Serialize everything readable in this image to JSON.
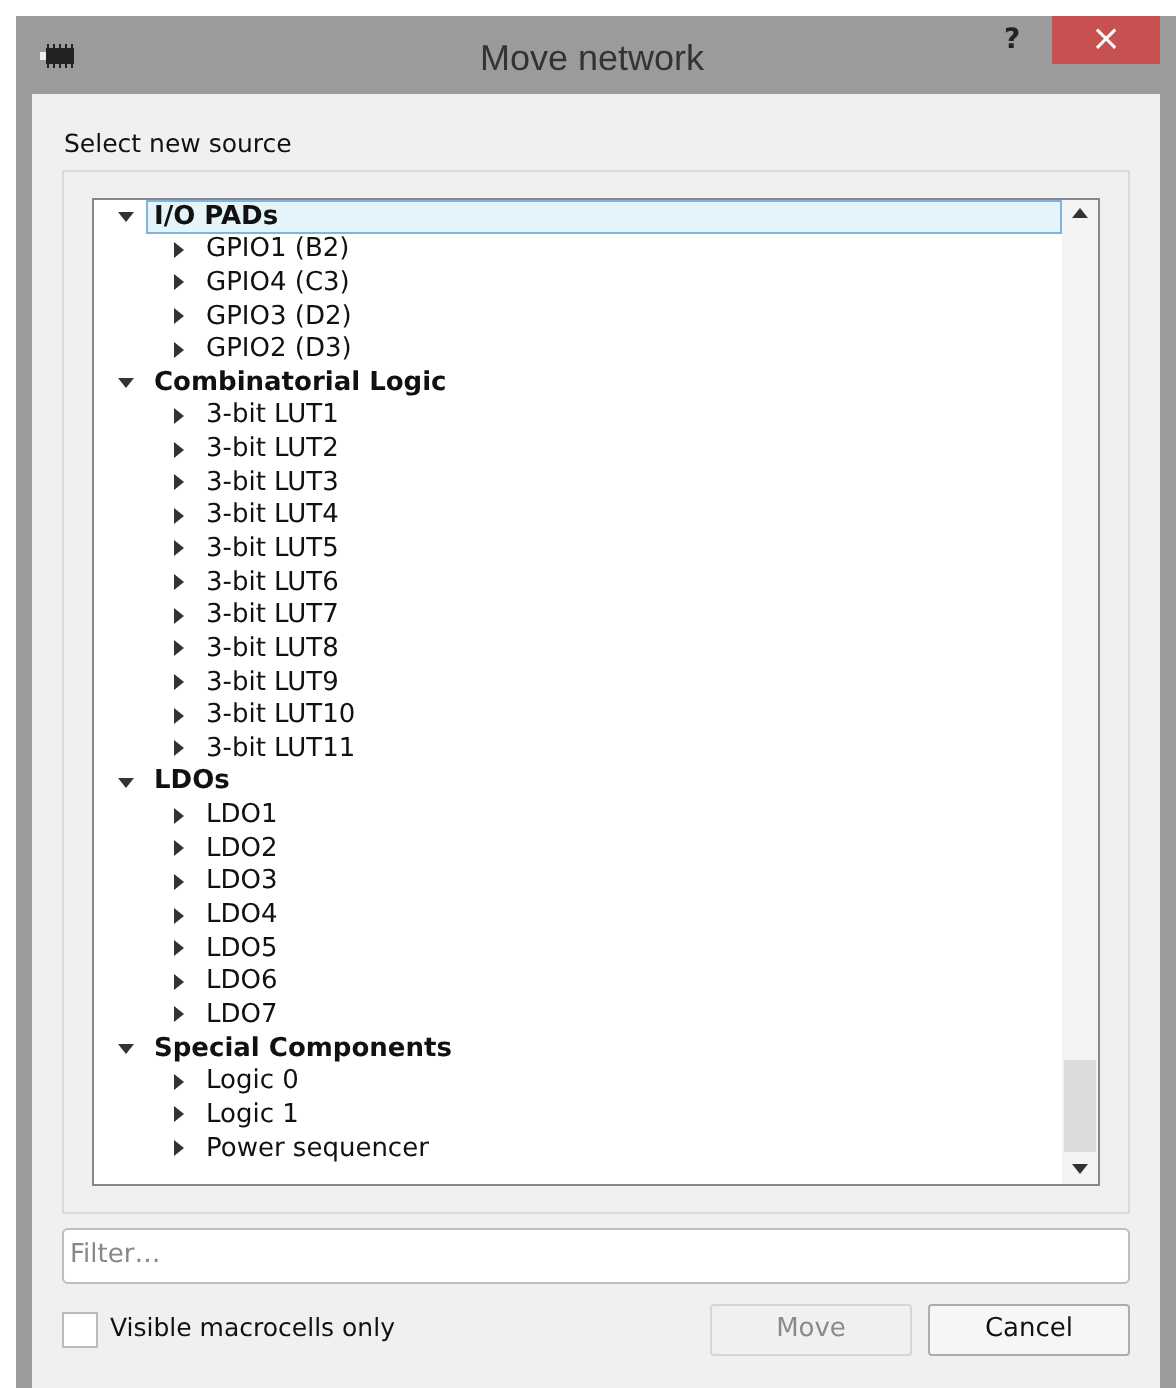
{
  "window": {
    "title": "Move network",
    "help": "?",
    "close": "×"
  },
  "prompt": "Select new source",
  "tree": [
    {
      "label": "I/O PADs",
      "expanded": true,
      "selected": true,
      "children": [
        {
          "label": "GPIO1 (B2)",
          "expanded": false
        },
        {
          "label": "GPIO4 (C3)",
          "expanded": false
        },
        {
          "label": "GPIO3 (D2)",
          "expanded": false
        },
        {
          "label": "GPIO2 (D3)",
          "expanded": false
        }
      ]
    },
    {
      "label": "Combinatorial Logic",
      "expanded": true,
      "selected": false,
      "children": [
        {
          "label": "3-bit LUT1",
          "expanded": false
        },
        {
          "label": "3-bit LUT2",
          "expanded": false
        },
        {
          "label": "3-bit LUT3",
          "expanded": false
        },
        {
          "label": "3-bit LUT4",
          "expanded": false
        },
        {
          "label": "3-bit LUT5",
          "expanded": false
        },
        {
          "label": "3-bit LUT6",
          "expanded": false
        },
        {
          "label": "3-bit LUT7",
          "expanded": false
        },
        {
          "label": "3-bit LUT8",
          "expanded": false
        },
        {
          "label": "3-bit LUT9",
          "expanded": false
        },
        {
          "label": "3-bit LUT10",
          "expanded": false
        },
        {
          "label": "3-bit LUT11",
          "expanded": false
        }
      ]
    },
    {
      "label": "LDOs",
      "expanded": true,
      "selected": false,
      "children": [
        {
          "label": "LDO1",
          "expanded": false
        },
        {
          "label": "LDO2",
          "expanded": false
        },
        {
          "label": "LDO3",
          "expanded": false
        },
        {
          "label": "LDO4",
          "expanded": false
        },
        {
          "label": "LDO5",
          "expanded": false
        },
        {
          "label": "LDO6",
          "expanded": false
        },
        {
          "label": "LDO7",
          "expanded": false
        }
      ]
    },
    {
      "label": "Special Components",
      "expanded": true,
      "selected": false,
      "children": [
        {
          "label": "Logic 0",
          "expanded": false
        },
        {
          "label": "Logic 1",
          "expanded": false
        },
        {
          "label": "Power sequencer",
          "expanded": false
        }
      ]
    }
  ],
  "filter": {
    "placeholder": "Filter…"
  },
  "visible_only": {
    "label": "Visible macrocells only",
    "checked": false
  },
  "buttons": [
    {
      "label": "Move",
      "disabled": true
    },
    {
      "label": "Cancel",
      "disabled": false
    }
  ]
}
